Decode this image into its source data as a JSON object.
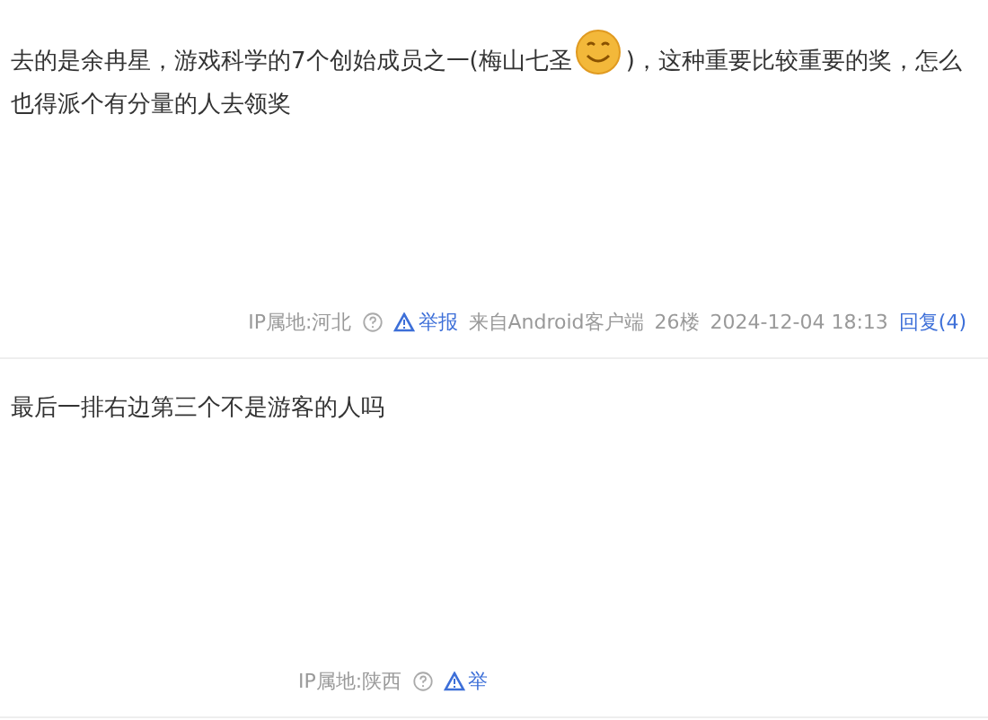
{
  "posts": [
    {
      "content_before": "去的是余冉星，游戏科学的7个创始成员之一(梅山七圣",
      "content_after": ")，这种重要比较重要的奖，怎么也得派个有分量的人去领奖",
      "footer": {
        "ip": "IP属地:河北",
        "report": "举报",
        "source": "来自Android客户端",
        "floor": "26楼",
        "time": "2024-12-04 18:13",
        "reply": "回复(4)"
      }
    },
    {
      "content_before": "最后一排右边第三个不是游客的人吗",
      "footer": {
        "ip": "IP属地:陕西",
        "report": "举"
      }
    }
  ]
}
